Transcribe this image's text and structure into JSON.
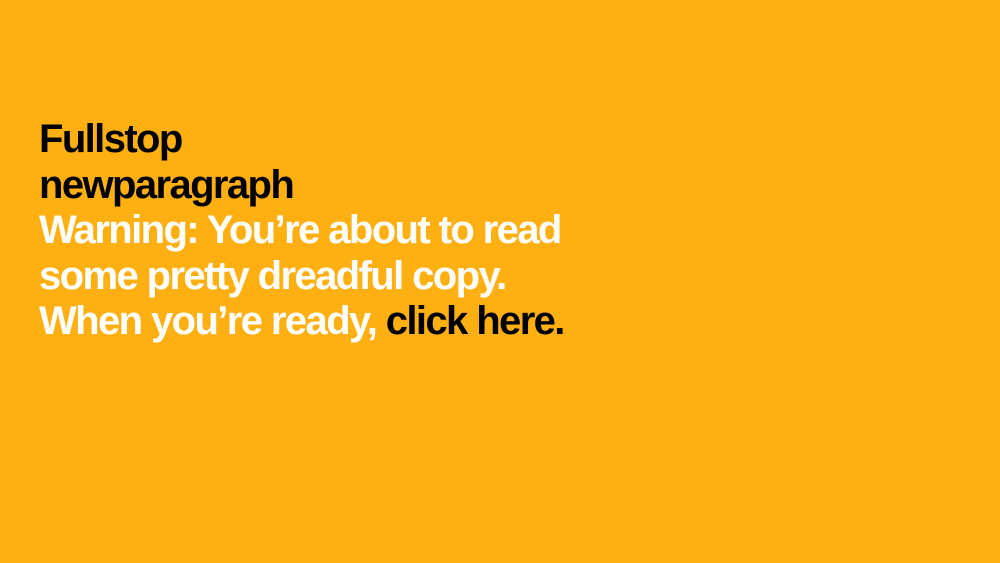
{
  "heading": {
    "line1": "Fullstop",
    "line2": "newparagraph"
  },
  "message": {
    "line1": "Warning: You’re about to read",
    "line2": "some pretty dreadful copy.",
    "line3_prefix": "When you’re ready,",
    "link_label": "click here."
  },
  "colors": {
    "background": "#FEB013",
    "heading": "#000000",
    "message": "#FFFFFF",
    "link": "#000000"
  }
}
